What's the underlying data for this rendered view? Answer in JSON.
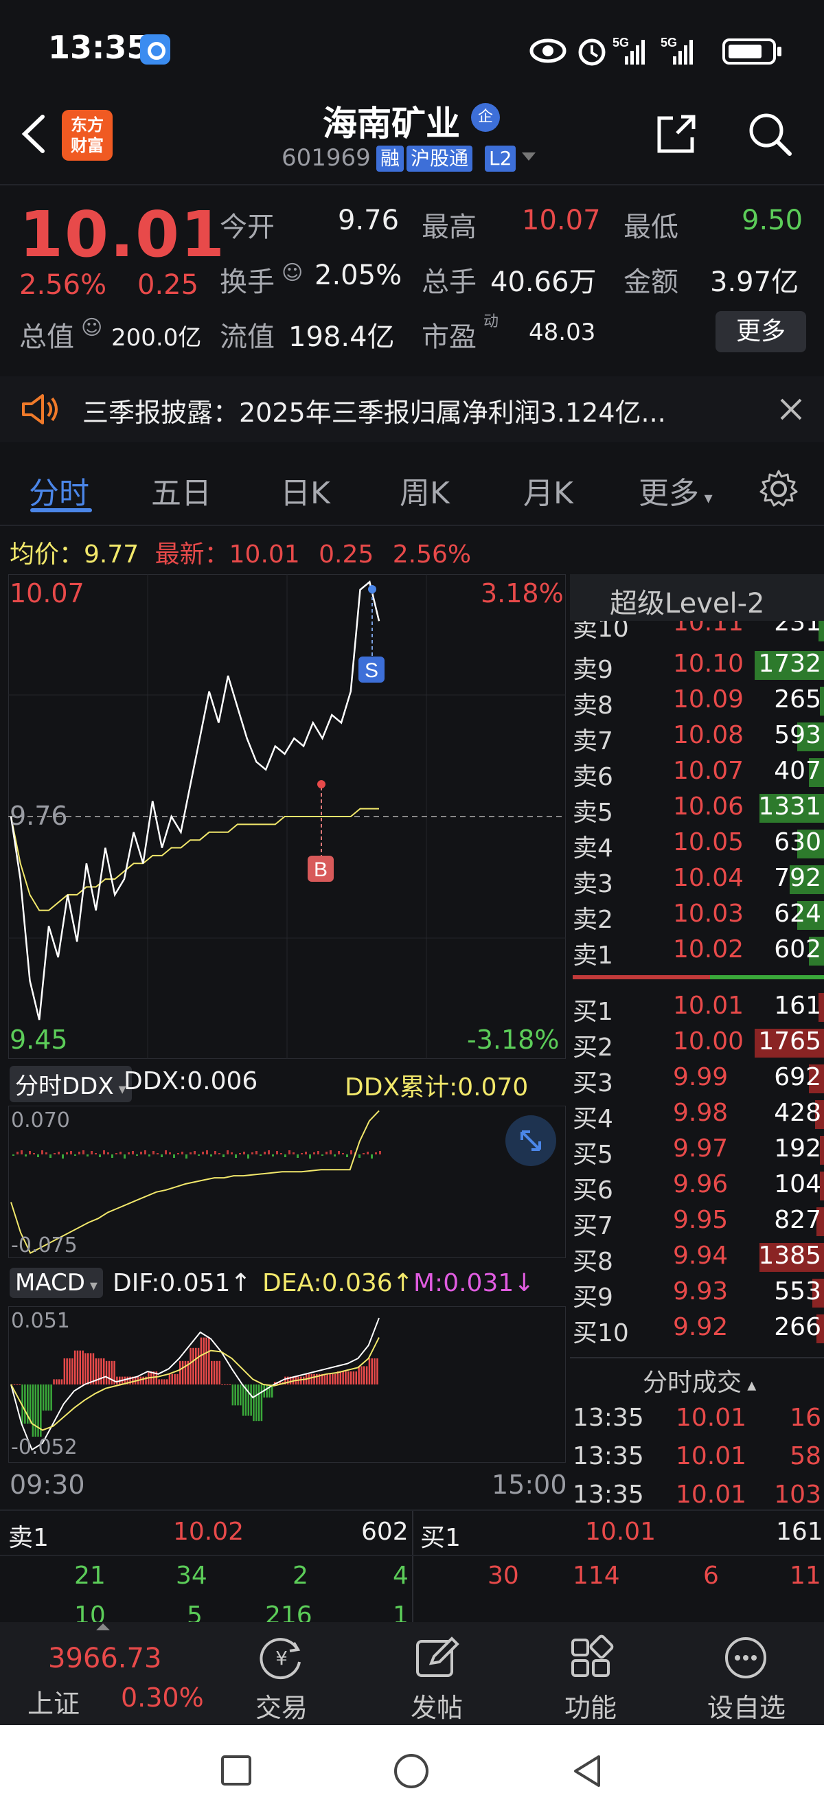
{
  "status_bar": {
    "time": "13:35",
    "signal1": "5G",
    "signal2": "5G"
  },
  "header": {
    "stock_name": "海南矿业",
    "badge": "企",
    "logo_line1": "东方",
    "logo_line2": "财富",
    "stock_code": "601969",
    "tags": [
      "融",
      "沪股通",
      "L2"
    ]
  },
  "quote": {
    "price": "10.01",
    "change_pct": "2.56%",
    "change_amt": "0.25",
    "open_label": "今开",
    "open": "9.76",
    "high_label": "最高",
    "high": "10.07",
    "low_label": "最低",
    "low": "9.50",
    "turnover_label": "换手",
    "turnover": "2.05%",
    "volume_label": "总手",
    "volume": "40.66万",
    "amount_label": "金额",
    "amount": "3.97亿",
    "mktcap_label": "总值",
    "mktcap": "200.0亿",
    "float_label": "流值",
    "float": "198.4亿",
    "pe_label": "市盈",
    "pe_sup": "动",
    "pe": "48.03",
    "more_label": "更多"
  },
  "announcement": {
    "text": "三季报披露：2025年三季报归属净利润3.124亿..."
  },
  "tabs": [
    "分时",
    "五日",
    "日K",
    "周K",
    "月K",
    "更多"
  ],
  "info_bar": {
    "avg_label": "均价：",
    "avg": "9.77",
    "latest_label": "最新：",
    "latest": "10.01",
    "chg": "0.25",
    "pct": "2.56%"
  },
  "chart_data": {
    "type": "line",
    "price_max": "10.07",
    "price_ref": "9.76",
    "price_min": "9.45",
    "pct_max": "3.18%",
    "pct_min": "-3.18%",
    "time_start": "09:30",
    "time_end": "15:00",
    "marker_b": "B",
    "marker_s": "S",
    "ylim": [
      9.45,
      10.07
    ],
    "price_series": [
      9.76,
      9.68,
      9.55,
      9.5,
      9.62,
      9.58,
      9.66,
      9.6,
      9.7,
      9.64,
      9.72,
      9.66,
      9.68,
      9.74,
      9.7,
      9.78,
      9.72,
      9.76,
      9.74,
      9.8,
      9.86,
      9.92,
      9.88,
      9.94,
      9.9,
      9.86,
      9.83,
      9.82,
      9.85,
      9.84,
      9.86,
      9.85,
      9.88,
      9.86,
      9.89,
      9.88,
      9.92,
      10.05,
      10.06,
      10.01
    ],
    "avg_series": [
      9.76,
      9.7,
      9.66,
      9.64,
      9.64,
      9.65,
      9.66,
      9.66,
      9.67,
      9.67,
      9.68,
      9.68,
      9.69,
      9.7,
      9.7,
      9.71,
      9.71,
      9.72,
      9.72,
      9.73,
      9.73,
      9.74,
      9.74,
      9.74,
      9.75,
      9.75,
      9.75,
      9.75,
      9.75,
      9.76,
      9.76,
      9.76,
      9.76,
      9.76,
      9.76,
      9.76,
      9.76,
      9.77,
      9.77,
      9.77
    ],
    "ddx_series": [
      -0.02,
      -0.05,
      -0.07,
      -0.065,
      -0.06,
      -0.055,
      -0.05,
      -0.045,
      -0.04,
      -0.036,
      -0.03,
      -0.026,
      -0.022,
      -0.018,
      -0.014,
      -0.01,
      -0.008,
      -0.005,
      -0.002,
      0,
      0.002,
      0.004,
      0.004,
      0.006,
      0.006,
      0.007,
      0.008,
      0.009,
      0.01,
      0.01,
      0.01,
      0.011,
      0.012,
      0.012,
      0.012,
      0.012,
      0.04,
      0.06,
      0.07
    ],
    "macd_dif": [
      0,
      -0.03,
      -0.05,
      -0.045,
      -0.03,
      -0.015,
      -0.005,
      0,
      0.003,
      0.006,
      0.002,
      0.004,
      0.006,
      0.01,
      0.008,
      0.012,
      0.02,
      0.03,
      0.04,
      0.035,
      0.025,
      0.012,
      0,
      -0.01,
      -0.005,
      0,
      0.004,
      0.006,
      0.008,
      0.01,
      0.012,
      0.014,
      0.016,
      0.02,
      0.03,
      0.051
    ],
    "macd_dea": [
      0,
      -0.015,
      -0.03,
      -0.035,
      -0.032,
      -0.025,
      -0.018,
      -0.012,
      -0.007,
      -0.003,
      -0.001,
      0.001,
      0.003,
      0.005,
      0.006,
      0.008,
      0.011,
      0.016,
      0.022,
      0.026,
      0.025,
      0.02,
      0.012,
      0.004,
      0,
      -0.001,
      0.001,
      0.003,
      0.004,
      0.006,
      0.008,
      0.009,
      0.011,
      0.013,
      0.02,
      0.036
    ]
  },
  "ddx_panel": {
    "dropdown": "分时DDX",
    "ddx": "DDX:0.006",
    "ddx_cum": "DDX累计:0.070",
    "max": "0.070",
    "min": "-0.075"
  },
  "macd_panel": {
    "dropdown": "MACD",
    "dif": "DIF:0.051↑",
    "dea": "DEA:0.036↑",
    "m": "M:0.031↓",
    "max": "0.051",
    "min": "-0.052"
  },
  "order_book": {
    "title": "超级Level-2",
    "sells": [
      {
        "label": "卖10",
        "price": "10.11",
        "vol": "231",
        "bar": 0.07
      },
      {
        "label": "卖9",
        "price": "10.10",
        "vol": "1732",
        "bar": 0.92
      },
      {
        "label": "卖8",
        "price": "10.09",
        "vol": "265",
        "bar": 0.05
      },
      {
        "label": "卖7",
        "price": "10.08",
        "vol": "593",
        "bar": 0.35
      },
      {
        "label": "卖6",
        "price": "10.07",
        "vol": "407",
        "bar": 0.2
      },
      {
        "label": "卖5",
        "price": "10.06",
        "vol": "1331",
        "bar": 0.85
      },
      {
        "label": "卖4",
        "price": "10.05",
        "vol": "630",
        "bar": 0.35
      },
      {
        "label": "卖3",
        "price": "10.04",
        "vol": "792",
        "bar": 0.45
      },
      {
        "label": "卖2",
        "price": "10.03",
        "vol": "624",
        "bar": 0.35
      },
      {
        "label": "卖1",
        "price": "10.02",
        "vol": "602",
        "bar": 0.2
      }
    ],
    "buys": [
      {
        "label": "买1",
        "price": "10.01",
        "vol": "161",
        "bar": 0.07
      },
      {
        "label": "买2",
        "price": "10.00",
        "vol": "1765",
        "bar": 0.92
      },
      {
        "label": "买3",
        "price": "9.99",
        "vol": "692",
        "bar": 0.2
      },
      {
        "label": "买4",
        "price": "9.98",
        "vol": "428",
        "bar": 0.12
      },
      {
        "label": "买5",
        "price": "9.97",
        "vol": "192",
        "bar": 0.05
      },
      {
        "label": "买6",
        "price": "9.96",
        "vol": "104",
        "bar": 0.05
      },
      {
        "label": "买7",
        "price": "9.95",
        "vol": "827",
        "bar": 0.1
      },
      {
        "label": "买8",
        "price": "9.94",
        "vol": "1385",
        "bar": 0.85
      },
      {
        "label": "买9",
        "price": "9.93",
        "vol": "553",
        "bar": 0.15
      },
      {
        "label": "买10",
        "price": "9.92",
        "vol": "266",
        "bar": 0.1
      }
    ],
    "trades_label": "分时成交",
    "trades": [
      {
        "time": "13:35",
        "price": "10.01",
        "vol": "16"
      },
      {
        "time": "13:35",
        "price": "10.01",
        "vol": "58"
      },
      {
        "time": "13:35",
        "price": "10.01",
        "vol": "103"
      }
    ]
  },
  "detail": {
    "sell_label": "卖1",
    "sell_price": "10.02",
    "sell_vol": "602",
    "buy_label": "买1",
    "buy_price": "10.01",
    "buy_vol": "161",
    "sell_row1": [
      "21",
      "34",
      "2",
      "4"
    ],
    "buy_row1": [
      "30",
      "114",
      "6",
      "11"
    ],
    "sell_row2": [
      "10",
      "5",
      "216",
      "1"
    ]
  },
  "bottom_nav": {
    "index_value": "3966.73",
    "index_name": "上证",
    "index_pct": "0.30%",
    "items": [
      "交易",
      "发帖",
      "功能",
      "设自选"
    ]
  },
  "colors": {
    "up": "#e84a4a",
    "down": "#5ccd59",
    "accent": "#4b86e8",
    "avg_line": "#f2e86b"
  }
}
